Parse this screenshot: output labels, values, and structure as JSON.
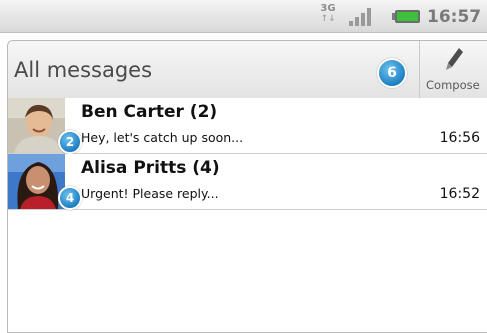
{
  "status_bar": {
    "network": "3G",
    "time": "16:57"
  },
  "header": {
    "title": "All messages",
    "unread_count": "6",
    "compose_label": "Compose"
  },
  "threads": [
    {
      "name": "Ben Carter (2)",
      "preview": "Hey, let's catch up soon...",
      "time": "16:56",
      "badge": "2"
    },
    {
      "name": "Alisa Pritts (4)",
      "preview": "Urgent! Please reply...",
      "time": "16:52",
      "badge": "4"
    }
  ],
  "colors": {
    "accent": "#2a8ed0",
    "battery": "#3cbf3a"
  },
  "icons": [
    "network-3g-icon",
    "signal-icon",
    "battery-icon",
    "pencil-icon"
  ]
}
